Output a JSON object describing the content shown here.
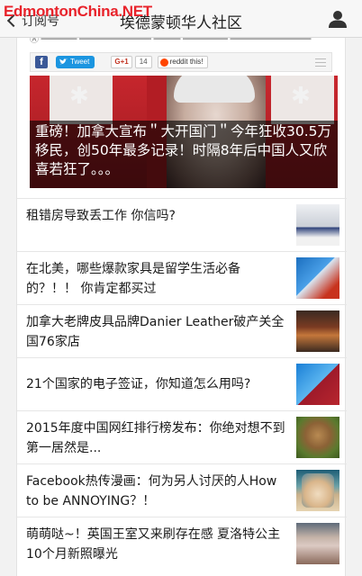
{
  "watermark": "EdmontonChina.NET",
  "nav": {
    "back_label": "订阅号",
    "title": "埃德蒙顿华人社区",
    "profile_icon": "person-icon"
  },
  "share": {
    "facebook": "f",
    "tweet": "Tweet",
    "gplus": "G+1",
    "gplus_count": "14",
    "reddit": "reddit this!"
  },
  "hero": {
    "caption": "重磅！加拿大宣布＂大开国门＂今年狂收30.5万移民，创50年最多记录！时隔8年后中国人又欣喜若狂了。。。"
  },
  "articles": [
    {
      "title": "租错房导致丢工作 你信吗?"
    },
    {
      "title": "在北美，哪些爆款家具是留学生活必备的？！！ 你肯定都买过"
    },
    {
      "title": "加拿大老牌皮具品牌Danier Leather破产关全国76家店"
    },
    {
      "title": "21个国家的电子签证，你知道怎么用吗?"
    },
    {
      "title": "2015年度中国网红排行榜发布：你绝对想不到第一居然是..."
    },
    {
      "title": "Facebook热传漫画：何为另人讨厌的人How to be ANNOYING？！"
    },
    {
      "title": "萌萌哒~！英国王室又来刷存在感 夏洛特公主10个月新照曝光"
    }
  ]
}
